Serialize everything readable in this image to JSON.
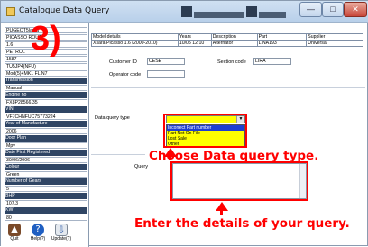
{
  "window": {
    "title": "Catalogue Data Query"
  },
  "left_fields": [
    {
      "text": "PUGEOT5lama",
      "dark": false
    },
    {
      "text": "PICASSO ROUTE",
      "dark": false
    },
    {
      "text": "1.6",
      "dark": false
    },
    {
      "text": "PETROL",
      "dark": false
    },
    {
      "text": "1587",
      "dark": false
    },
    {
      "text": "TU5JP4(NFU)",
      "dark": false
    },
    {
      "text": "Mod(5)+MK1 FL N7",
      "dark": false
    },
    {
      "text": "Transmission",
      "dark": true
    },
    {
      "text": "Manual",
      "dark": false
    },
    {
      "text": "Engine no",
      "dark": true
    },
    {
      "text": "FX8P28566.35",
      "dark": false
    },
    {
      "text": "VIN",
      "dark": true
    },
    {
      "text": "VF7CHNFUC75773224",
      "dark": false
    },
    {
      "text": "Year of Manufacture",
      "dark": true
    },
    {
      "text": "2006",
      "dark": false
    },
    {
      "text": "Door Plan",
      "dark": true
    },
    {
      "text": "Mpv",
      "dark": false
    },
    {
      "text": "Date First Registered",
      "dark": true
    },
    {
      "text": "30/06/2006",
      "dark": false
    },
    {
      "text": "Colour",
      "dark": true
    },
    {
      "text": "Green",
      "dark": false
    },
    {
      "text": "Number of Gears",
      "dark": true
    },
    {
      "text": "5",
      "dark": false
    },
    {
      "text": "BHP",
      "dark": true
    },
    {
      "text": "107.3",
      "dark": false
    },
    {
      "text": "KW",
      "dark": true
    },
    {
      "text": "80",
      "dark": false
    }
  ],
  "bottom_icons": [
    {
      "label": "Quit",
      "icon": "quit-icon"
    },
    {
      "label": "Help(?)",
      "icon": "help-icon"
    },
    {
      "label": "Update(?)",
      "icon": "update-icon"
    }
  ],
  "overlay_number": "3)",
  "details_table": {
    "headers": [
      "Model details",
      "Years",
      "Description",
      "Part",
      "Supplier"
    ],
    "row": [
      "Xsara Picasso 1.6 (2000-2010)",
      "10/05 12/10",
      "Alternator",
      "LINA193",
      "Universal"
    ]
  },
  "customer_id": {
    "label": "Customer ID",
    "value": "CESE"
  },
  "section_code": {
    "label": "Section code",
    "value": "LIRA"
  },
  "operator_code": {
    "label": "Operator code",
    "value": ""
  },
  "data_query_type": {
    "label": "Data query type",
    "options": [
      "Incorrect Part number",
      "Part Not On File",
      "Lost Sale",
      "Other"
    ],
    "selected_index": 0
  },
  "callout_1": "Choose Data query type.",
  "query": {
    "label": "Query",
    "value": ""
  },
  "callout_2": "Enter the details of your query.",
  "colors": {
    "annotation": "#ff0000",
    "highlight": "#ffff00",
    "dark_field": "#2f4564"
  }
}
